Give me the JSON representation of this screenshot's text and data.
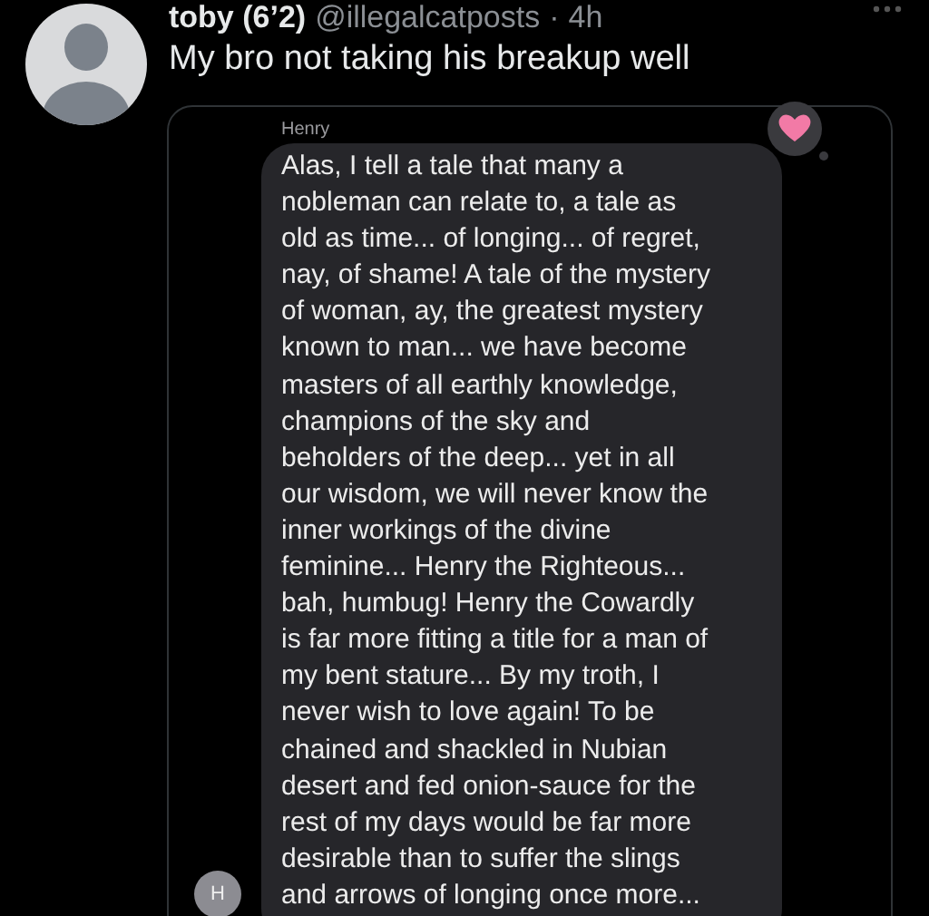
{
  "tweet": {
    "display_name": "toby (6’2)",
    "handle": "@illegalcatposts",
    "separator": "·",
    "time": "4h",
    "text": "My bro not taking his breakup well"
  },
  "embedded_chat": {
    "sender_name": "Henry",
    "sender_initial": "H",
    "message": "Alas, I tell a tale that many a\nnobleman can relate to, a tale as\nold as time... of longing... of regret,\nnay, of shame! A tale of the mystery\nof woman, ay, the greatest mystery\nknown to man... we have become\nmasters of all earthly knowledge,\nchampions of the sky and\nbeholders of the deep... yet in all\nour wisdom, we will never know the\ninner workings of the divine\nfeminine... Henry the Righteous...\nbah, humbug! Henry the Cowardly\nis far more fitting a title for a man of\nmy bent stature... By my troth, I\nnever wish to love again! To be\nchained and shackled in Nubian\ndesert and fed onion-sauce for the\nrest of my days would be far more\ndesirable than to suffer the slings\nand arrows of longing once more..."
  }
}
